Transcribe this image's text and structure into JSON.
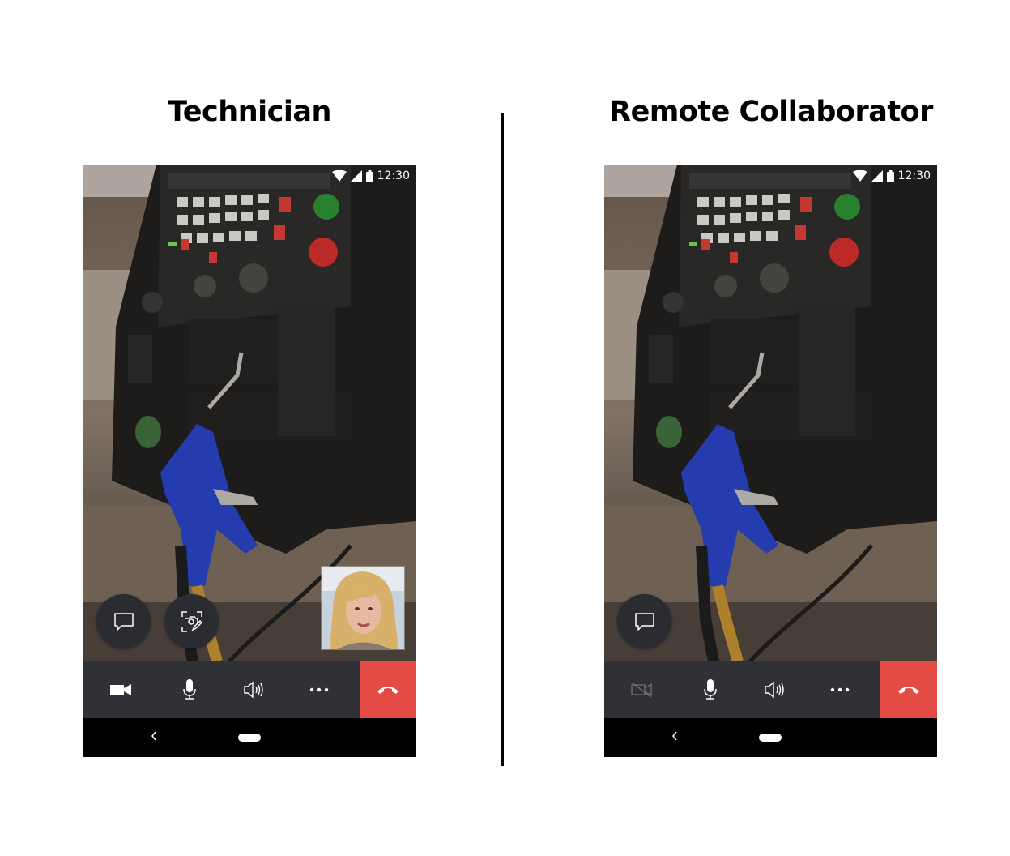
{
  "headings": {
    "left": "Technician",
    "right": "Remote Collaborator"
  },
  "status": {
    "time": "12:30"
  },
  "colors": {
    "end_call": "#e34b45",
    "callbar": "#2f3136",
    "fab": "#2b2c31"
  },
  "technician": {
    "fabs": [
      {
        "icon": "chat-icon"
      },
      {
        "icon": "snapshot-annotate-icon"
      }
    ],
    "pip": "self-view-thumbnail",
    "call_controls": [
      {
        "icon": "video-camera-icon",
        "state": "on"
      },
      {
        "icon": "microphone-icon",
        "state": "on"
      },
      {
        "icon": "speaker-icon",
        "state": "on"
      },
      {
        "icon": "more-options-icon"
      },
      {
        "icon": "end-call-icon"
      }
    ]
  },
  "remote": {
    "fabs": [
      {
        "icon": "chat-icon"
      }
    ],
    "call_controls": [
      {
        "icon": "video-camera-off-icon",
        "state": "off"
      },
      {
        "icon": "microphone-icon",
        "state": "on"
      },
      {
        "icon": "speaker-icon",
        "state": "on"
      },
      {
        "icon": "more-options-icon"
      },
      {
        "icon": "end-call-icon"
      }
    ]
  }
}
